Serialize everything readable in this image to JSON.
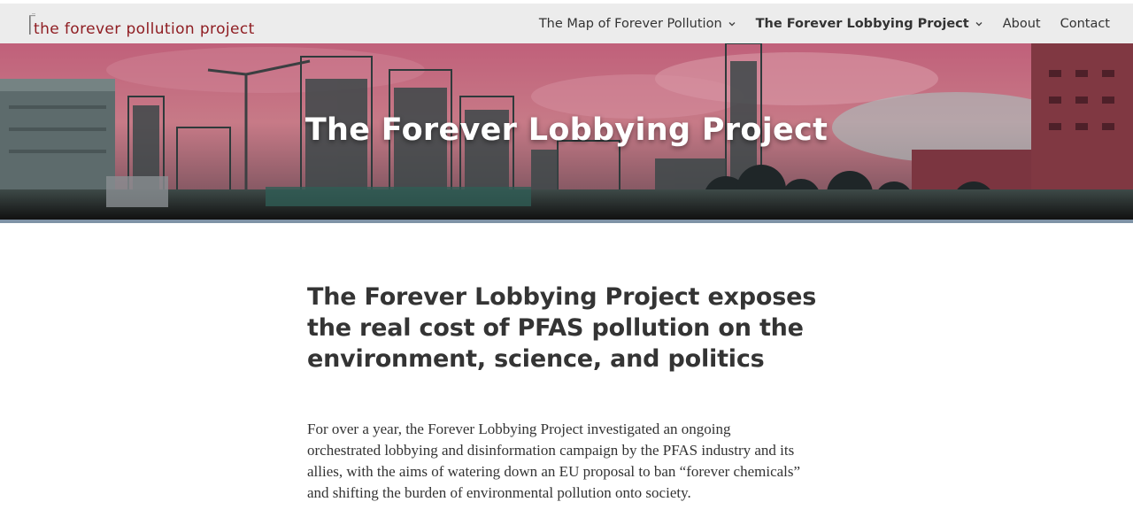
{
  "site": {
    "logo_text": "the forever pollution project"
  },
  "nav": {
    "items": [
      {
        "label": "The Map of Forever Pollution",
        "has_dropdown": true,
        "active": false
      },
      {
        "label": "The Forever Lobbying Project",
        "has_dropdown": true,
        "active": true
      },
      {
        "label": "About",
        "has_dropdown": false,
        "active": false
      },
      {
        "label": "Contact",
        "has_dropdown": false,
        "active": false
      }
    ]
  },
  "hero": {
    "title": "The Forever Lobbying Project"
  },
  "article": {
    "headline": "The Forever Lobbying Project exposes the real cost of PFAS pollution on the environment, science, and politics",
    "intro": "For over a year, the Forever Lobbying Project investigated an ongoing orchestrated lobbying and disinformation campaign by the PFAS industry and its allies, with the aims of watering down an EU proposal to ban “forever chemicals” and shifting the burden of environmental pollution onto society."
  },
  "colors": {
    "brand": "#8f1d22",
    "header_bg": "#ececec",
    "hero_rule": "#7f93a6",
    "text": "#333333"
  }
}
